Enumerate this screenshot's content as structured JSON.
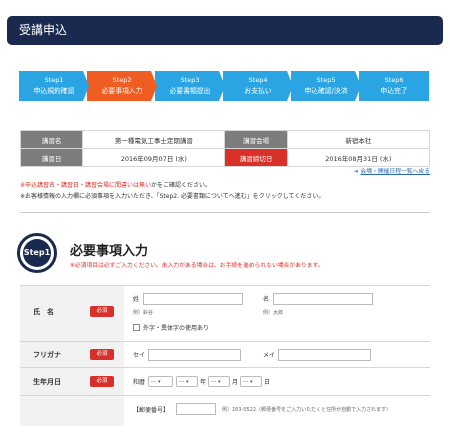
{
  "header": {
    "title": "受講申込"
  },
  "steps": [
    {
      "num": "Step1",
      "label": "申込規約確認",
      "color": "#2aa4e3"
    },
    {
      "num": "Step2",
      "label": "必要事項入力",
      "color": "#f05d23"
    },
    {
      "num": "Step3",
      "label": "必要書類提出",
      "color": "#2aa4e3"
    },
    {
      "num": "Step4",
      "label": "お支払い",
      "color": "#2aa4e3"
    },
    {
      "num": "Step5",
      "label": "申込確認/決済",
      "color": "#2aa4e3"
    },
    {
      "num": "Step6",
      "label": "申込完了",
      "color": "#2aa4e3"
    }
  ],
  "info": {
    "course_name_label": "講習名",
    "course_name": "第一種電気工事士定期講習",
    "venue_label": "講習会場",
    "venue": "新宿本社",
    "date_label": "講習日",
    "date": "2016年09月07日 (水)",
    "deadline_label": "講習締切日",
    "deadline": "2016年08月31日 (水)"
  },
  "link_text": "会場・開催日程一覧へ戻る",
  "notes": {
    "note1_red": "※申込講習名・講習日・講習会場に間違いは無い",
    "note1_rest": "かをご確認ください。",
    "note2": "※お客様情報の入力欄に必須事項を入力いただき、「Step2. 必要書類についてへ進む」をクリックしてください。"
  },
  "section": {
    "circle": "Step1",
    "title": "必要事項入力",
    "subtitle": "※必須項目は必ずご入力ください。未入力がある場合は、お手続を進められない場合があります。"
  },
  "form": {
    "required_badge": "必須",
    "name": {
      "label": "氏　名",
      "sei_label": "姓",
      "mei_label": "名",
      "sei_example": "例）鈴谷",
      "mei_example": "例）太郎",
      "foreign_label": "外字・異体字の使用あり"
    },
    "furigana": {
      "label": "フリガナ",
      "sei_label": "セイ",
      "mei_label": "メイ"
    },
    "birth": {
      "label": "生年月日",
      "era": "和暦",
      "era_value": "---",
      "year_value": "---",
      "year_unit": "年",
      "month_value": "---",
      "month_unit": "月",
      "day_value": "---",
      "day_unit": "日"
    },
    "postal": {
      "label": "【郵便番号】",
      "example": "例）163-0522（郵便番号をご入力いただくと住所が自動で入力されます）"
    }
  }
}
